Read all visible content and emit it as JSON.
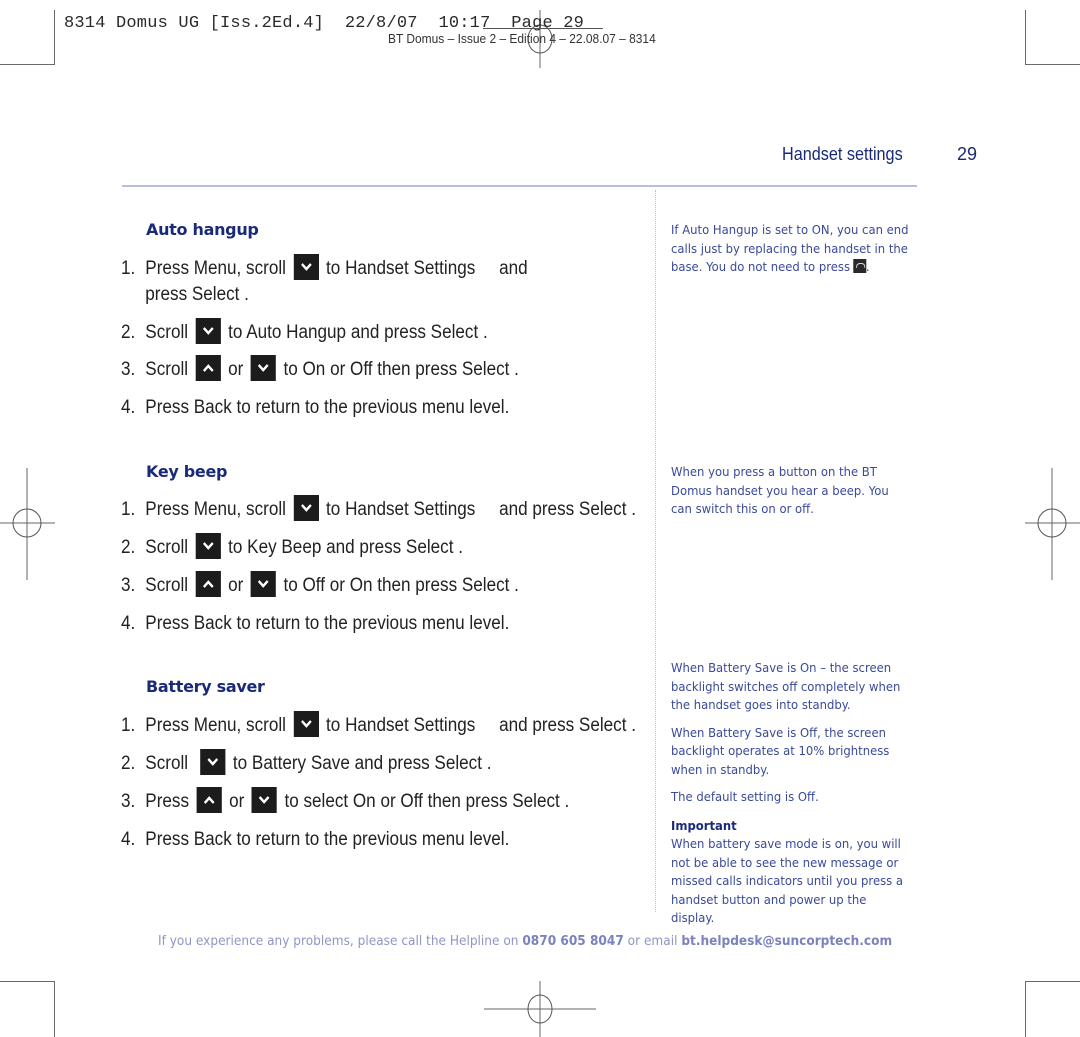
{
  "slug": {
    "line1": "8314 Domus UG [Iss.2Ed.4]  22/8/07  10:17  Page 29",
    "line2": "BT Domus – Issue 2 – Edition 4 – 22.08.07 – 8314"
  },
  "header": {
    "section_title": "Handset settings",
    "page_number": "29"
  },
  "sections": [
    {
      "heading": "Auto hangup",
      "steps": [
        {
          "num": "1.",
          "parts": [
            "Press Menu, scroll",
            "to Handset Settings",
            "and"
          ],
          "cont": "press Select  ."
        },
        {
          "num": "2.",
          "parts": [
            "Scroll",
            "to Auto Hangup  and press Select  ."
          ]
        },
        {
          "num": "3.",
          "parts": [
            "Scroll",
            "or",
            "to On or Off  then press Select  ."
          ]
        },
        {
          "num": "4.",
          "parts": [
            "Press Back to return to the previous menu level."
          ]
        }
      ],
      "note": [
        "If Auto Hangup is set to ON, you can end calls just by replacing the handset in the base. You do not need to press",
        "."
      ]
    },
    {
      "heading": "Key beep",
      "steps": [
        {
          "num": "1.",
          "parts": [
            "Press Menu, scroll",
            "to Handset Settings",
            "and press Select  ."
          ]
        },
        {
          "num": "2.",
          "parts": [
            "Scroll",
            "to Key Beep and press Select  ."
          ]
        },
        {
          "num": "3.",
          "parts": [
            "Scroll",
            "or",
            "to Off  or On then press Select  ."
          ]
        },
        {
          "num": "4.",
          "parts": [
            "Press Back to return to the previous menu level."
          ]
        }
      ],
      "note": [
        "When you press a button on the BT Domus handset you hear a beep. You can switch this on or off."
      ]
    },
    {
      "heading": "Battery saver",
      "steps": [
        {
          "num": "1.",
          "parts": [
            "Press Menu, scroll",
            "to Handset  Settings",
            "and press Select  ."
          ]
        },
        {
          "num": "2.",
          "parts": [
            "Scroll",
            "to Battery   Save  and press Select  ."
          ]
        },
        {
          "num": "3.",
          "parts": [
            "Press",
            "or",
            "to select On or Off  then press Select  ."
          ]
        },
        {
          "num": "4.",
          "parts": [
            "Press Back to return to the previous menu level."
          ]
        }
      ],
      "note": [
        "When Battery Save is On – the screen backlight switches off completely when the handset goes into standby.",
        "When Battery Save is Off, the screen backlight operates at 10% brightness when in standby.",
        "The default setting is Off."
      ],
      "important_label": "Important",
      "important_text": "When battery save mode is on, you will not be able to see the new message or missed calls indicators until you press a handset button and power up the display."
    }
  ],
  "icons": {
    "scroll_down": "chevron-down-key",
    "scroll_up": "chevron-up-key",
    "end_call": "end-call-key"
  },
  "footer": {
    "text_before_phone": "If you experience any problems, please call the Helpline on ",
    "phone": "0870 605 8047",
    "text_before_email": " or email ",
    "email": "bt.helpdesk@suncorptech.com"
  },
  "colors": {
    "heading": "#1a2a78",
    "note_text": "#3a4a98",
    "footer_text": "#8f95c6",
    "rule": "#b9bde0"
  }
}
